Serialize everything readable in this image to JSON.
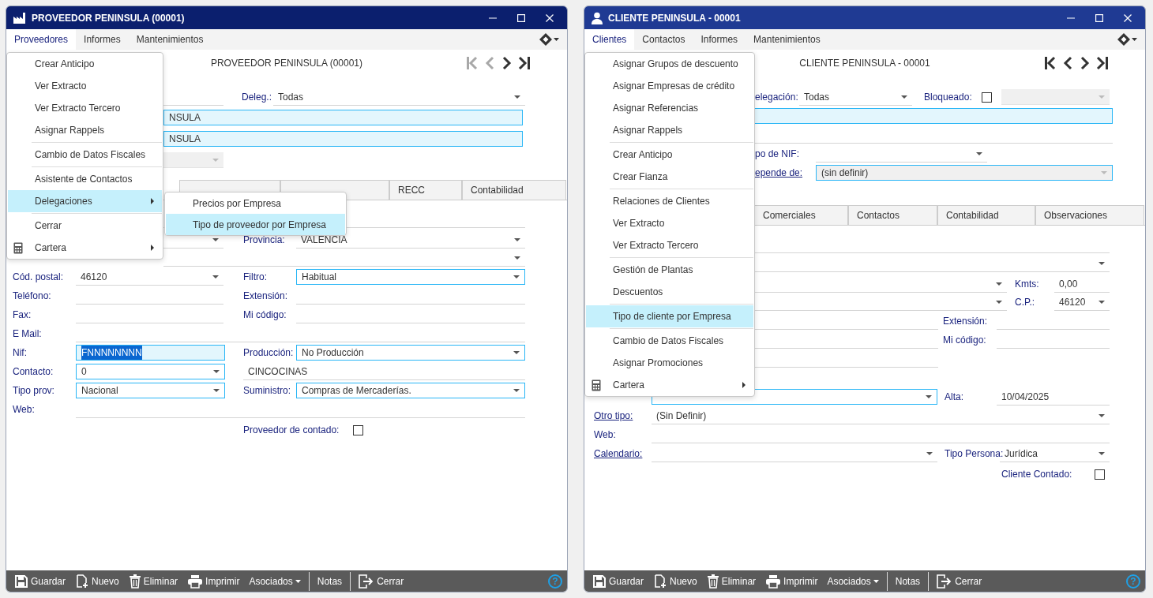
{
  "windows": [
    {
      "kind": "supplier",
      "color": "#0b1f6e",
      "title": "PROVEEDOR PENINSULA (00001)",
      "menubar": [
        {
          "label": "Proveedores",
          "selected": true
        },
        {
          "label": "Informes",
          "selected": false
        },
        {
          "label": "Mantenimientos",
          "selected": false
        }
      ],
      "header": "PROVEEDOR PENINSULA (00001)",
      "nav": [
        {
          "kind": "first",
          "disabled": true
        },
        {
          "kind": "prev",
          "disabled": true
        },
        {
          "kind": "next",
          "disabled": false
        },
        {
          "kind": "last",
          "disabled": false
        }
      ],
      "top_rows": [
        [
          "",
          {
            "kind": "line-input"
          },
          {
            "kind": "label",
            "text": "Deleg.:"
          },
          {
            "kind": "line-select",
            "value": "Todas"
          }
        ],
        [
          "",
          {
            "kind": "cyan-input",
            "value": "NSULA"
          }
        ],
        [
          "",
          {
            "kind": "cyan-input",
            "value": "NSULA"
          }
        ],
        [
          "",
          {
            "kind": "disabled-select"
          }
        ]
      ],
      "tabs": [
        {
          "selected": false
        },
        {
          "selected": false
        },
        {
          "label": "RECC",
          "selected": false
        },
        {
          "label": "Contabilidad",
          "selected": false
        }
      ],
      "rows": [
        [
          "",
          {
            "kind": "line-input"
          }
        ],
        [
          "",
          {
            "kind": "line-select"
          },
          {
            "kind": "label",
            "text": "Provincia:"
          },
          {
            "kind": "line-select",
            "value": "VALENCIA"
          }
        ],
        [
          "",
          {
            "kind": "line-select"
          }
        ],
        [
          {
            "kind": "label",
            "text": "Cód. postal:"
          },
          {
            "kind": "line-select",
            "value": "46120"
          },
          {
            "kind": "label",
            "text": "Filtro:"
          },
          {
            "kind": "boxed-select",
            "value": "Habitual"
          }
        ],
        [
          {
            "kind": "label",
            "text": "Teléfono:"
          },
          {
            "kind": "line-input"
          },
          {
            "kind": "label",
            "text": "Extensión:"
          },
          {
            "kind": "line-input"
          }
        ],
        [
          {
            "kind": "label",
            "text": "Fax:"
          },
          {
            "kind": "line-input"
          },
          {
            "kind": "label",
            "text": "Mi código:"
          },
          {
            "kind": "line-input"
          }
        ],
        [
          {
            "kind": "label",
            "text": "E Mail:"
          },
          {
            "kind": "line-input"
          }
        ],
        [
          {
            "kind": "label",
            "text": "Nif:"
          },
          {
            "kind": "cyan-input",
            "value": "FNNNNNNNN",
            "text_selected": true
          },
          {
            "kind": "label",
            "text": "Producción:"
          },
          {
            "kind": "boxed-select",
            "value": "No Producción"
          }
        ],
        [
          {
            "kind": "label",
            "text": "Contacto:"
          },
          {
            "kind": "boxed-select",
            "value": "0"
          },
          {
            "kind": "line-input",
            "value": "CINCOCINAS"
          }
        ],
        [
          {
            "kind": "label",
            "text": "Tipo prov:"
          },
          {
            "kind": "boxed-select",
            "value": "Nacional"
          },
          {
            "kind": "label",
            "text": "Suministro:"
          },
          {
            "kind": "boxed-select",
            "value": "Compras de Mercaderías."
          }
        ],
        [
          {
            "kind": "label",
            "text": "Web:"
          },
          {
            "kind": "line-input"
          }
        ],
        [
          "",
          "",
          {
            "kind": "label",
            "text": "Proveedor de contado:"
          },
          {
            "kind": "checkbox",
            "checked": false
          }
        ]
      ],
      "toolbar": [
        {
          "kind": "save",
          "label": "Guardar"
        },
        {
          "kind": "new",
          "label": "Nuevo"
        },
        {
          "kind": "delete",
          "label": "Eliminar"
        },
        {
          "kind": "print",
          "label": "Imprimir"
        },
        {
          "kind": "dropdown",
          "label": "Asociados"
        },
        {
          "kind": "separator"
        },
        {
          "kind": "plain",
          "label": "Notas"
        },
        {
          "kind": "separator"
        },
        {
          "kind": "exit",
          "label": "Cerrar"
        },
        {
          "kind": "help",
          "label": "?"
        }
      ],
      "menu": {
        "items": [
          {
            "kind": "item",
            "label": "Crear Anticipo",
            "selected": false
          },
          {
            "kind": "item",
            "label": "Ver Extracto",
            "selected": false
          },
          {
            "kind": "item",
            "label": "Ver Extracto Tercero",
            "selected": false
          },
          {
            "kind": "item",
            "label": "Asignar Rappels",
            "selected": false
          },
          {
            "kind": "separator"
          },
          {
            "kind": "item",
            "label": "Cambio de Datos Fiscales",
            "selected": false
          },
          {
            "kind": "separator"
          },
          {
            "kind": "item",
            "label": "Asistente de Contactos",
            "selected": false
          },
          {
            "kind": "submenu",
            "label": "Delegaciones",
            "selected": true
          },
          {
            "kind": "separator"
          },
          {
            "kind": "item",
            "label": "Cerrar",
            "selected": false
          },
          {
            "kind": "icon-submenu",
            "label": "Cartera",
            "selected": false
          }
        ],
        "submenu": [
          {
            "kind": "item",
            "label": "Precios por Empresa",
            "selected": false
          },
          {
            "kind": "item",
            "label": "Tipo de proveedor por Empresa",
            "selected": true
          }
        ]
      }
    },
    {
      "kind": "customer",
      "color": "#1f3a93",
      "title": "CLIENTE PENINSULA - 00001",
      "menubar": [
        {
          "label": "Clientes",
          "selected": true
        },
        {
          "label": "Contactos",
          "selected": false
        },
        {
          "label": "Informes",
          "selected": false
        },
        {
          "label": "Mantenimientos",
          "selected": false
        }
      ],
      "header": "CLIENTE PENINSULA - 00001",
      "nav": [
        {
          "kind": "first",
          "disabled": false
        },
        {
          "kind": "prev",
          "disabled": false
        },
        {
          "kind": "next",
          "disabled": false
        },
        {
          "kind": "last",
          "disabled": false
        }
      ],
      "top_rows": [
        [
          {
            "kind": "label",
            "text": "elegación:"
          },
          {
            "kind": "line-select",
            "value": "Todas"
          },
          {
            "kind": "label",
            "text": "Bloqueado:"
          },
          {
            "kind": "checkbox",
            "checked": false
          },
          {
            "kind": "disabled-select"
          }
        ],
        [
          {
            "kind": "cyan-input"
          }
        ],
        [
          {
            "kind": "line-input"
          }
        ],
        [
          {
            "kind": "label",
            "text": "po de NIF:"
          },
          {
            "kind": "line-select"
          }
        ],
        [
          {
            "kind": "link",
            "text": "epende de:"
          },
          {
            "kind": "boxed-disabled-select",
            "value": "(sin definir)"
          }
        ]
      ],
      "tabs": [
        {
          "label": "Comerciales",
          "selected": false
        },
        {
          "label": "Contactos",
          "selected": false
        },
        {
          "label": "Contabilidad",
          "selected": false
        },
        {
          "label": "Observaciones",
          "selected": false
        }
      ],
      "rows": [
        [
          "",
          {
            "kind": "line-input"
          }
        ],
        [
          "",
          {
            "kind": "line-select"
          }
        ],
        [
          "",
          {
            "kind": "line-select"
          },
          {
            "kind": "label",
            "text": "Kmts:"
          },
          {
            "kind": "line-input",
            "value": "0,00"
          }
        ],
        [
          "",
          {
            "kind": "line-select"
          },
          {
            "kind": "label",
            "text": "C.P.:"
          },
          {
            "kind": "line-select",
            "value": "46120"
          }
        ],
        [
          "",
          {
            "kind": "line-input"
          },
          {
            "kind": "label",
            "text": "Extensión:"
          },
          {
            "kind": "line-input"
          }
        ],
        [
          "",
          {
            "kind": "line-input"
          },
          {
            "kind": "label",
            "text": "Mi código:"
          },
          {
            "kind": "line-input"
          }
        ],
        [
          "",
          {
            "kind": "line-input"
          }
        ],
        [
          "",
          {
            "kind": "boxed-select"
          },
          {
            "kind": "label",
            "text": "Alta:"
          },
          {
            "kind": "line-input",
            "value": "10/04/2025"
          }
        ],
        [
          {
            "kind": "link",
            "text": "Otro tipo:"
          },
          {
            "kind": "line-select",
            "value": "(Sin Definir)"
          }
        ],
        [
          {
            "kind": "label",
            "text": "Web:"
          },
          {
            "kind": "line-input"
          }
        ],
        [
          {
            "kind": "link",
            "text": "Calendario:"
          },
          {
            "kind": "line-select"
          },
          {
            "kind": "label",
            "text": "Tipo Persona:"
          },
          {
            "kind": "line-select",
            "value": "Jurídica"
          }
        ],
        [
          "",
          "",
          {
            "kind": "label",
            "text": "Cliente Contado:"
          },
          {
            "kind": "checkbox",
            "checked": false
          }
        ]
      ],
      "toolbar": [
        {
          "kind": "save",
          "label": "Guardar"
        },
        {
          "kind": "new",
          "label": "Nuevo"
        },
        {
          "kind": "delete",
          "label": "Eliminar"
        },
        {
          "kind": "print",
          "label": "Imprimir"
        },
        {
          "kind": "dropdown",
          "label": "Asociados"
        },
        {
          "kind": "separator"
        },
        {
          "kind": "plain",
          "label": "Notas"
        },
        {
          "kind": "separator"
        },
        {
          "kind": "exit",
          "label": "Cerrar"
        },
        {
          "kind": "help",
          "label": "?"
        }
      ],
      "menu": {
        "items": [
          {
            "kind": "item",
            "label": "Asignar Grupos de descuento",
            "selected": false
          },
          {
            "kind": "item",
            "label": "Asignar Empresas de crédito",
            "selected": false
          },
          {
            "kind": "item",
            "label": "Asignar Referencias",
            "selected": false
          },
          {
            "kind": "item",
            "label": "Asignar Rappels",
            "selected": false
          },
          {
            "kind": "separator"
          },
          {
            "kind": "item",
            "label": "Crear Anticipo",
            "selected": false
          },
          {
            "kind": "item",
            "label": "Crear Fianza",
            "selected": false
          },
          {
            "kind": "separator"
          },
          {
            "kind": "item",
            "label": "Relaciones de Clientes",
            "selected": false
          },
          {
            "kind": "item",
            "label": "Ver Extracto",
            "selected": false
          },
          {
            "kind": "item",
            "label": "Ver Extracto Tercero",
            "selected": false
          },
          {
            "kind": "separator"
          },
          {
            "kind": "item",
            "label": "Gestión de Plantas",
            "selected": false
          },
          {
            "kind": "item",
            "label": "Descuentos",
            "selected": false
          },
          {
            "kind": "separator"
          },
          {
            "kind": "item",
            "label": "Tipo de cliente por Empresa",
            "selected": true
          },
          {
            "kind": "separator"
          },
          {
            "kind": "item",
            "label": "Cambio de Datos Fiscales",
            "selected": false
          },
          {
            "kind": "item",
            "label": "Asignar Promociones",
            "selected": false
          },
          {
            "kind": "icon-submenu",
            "label": "Cartera",
            "selected": false
          }
        ]
      }
    }
  ]
}
